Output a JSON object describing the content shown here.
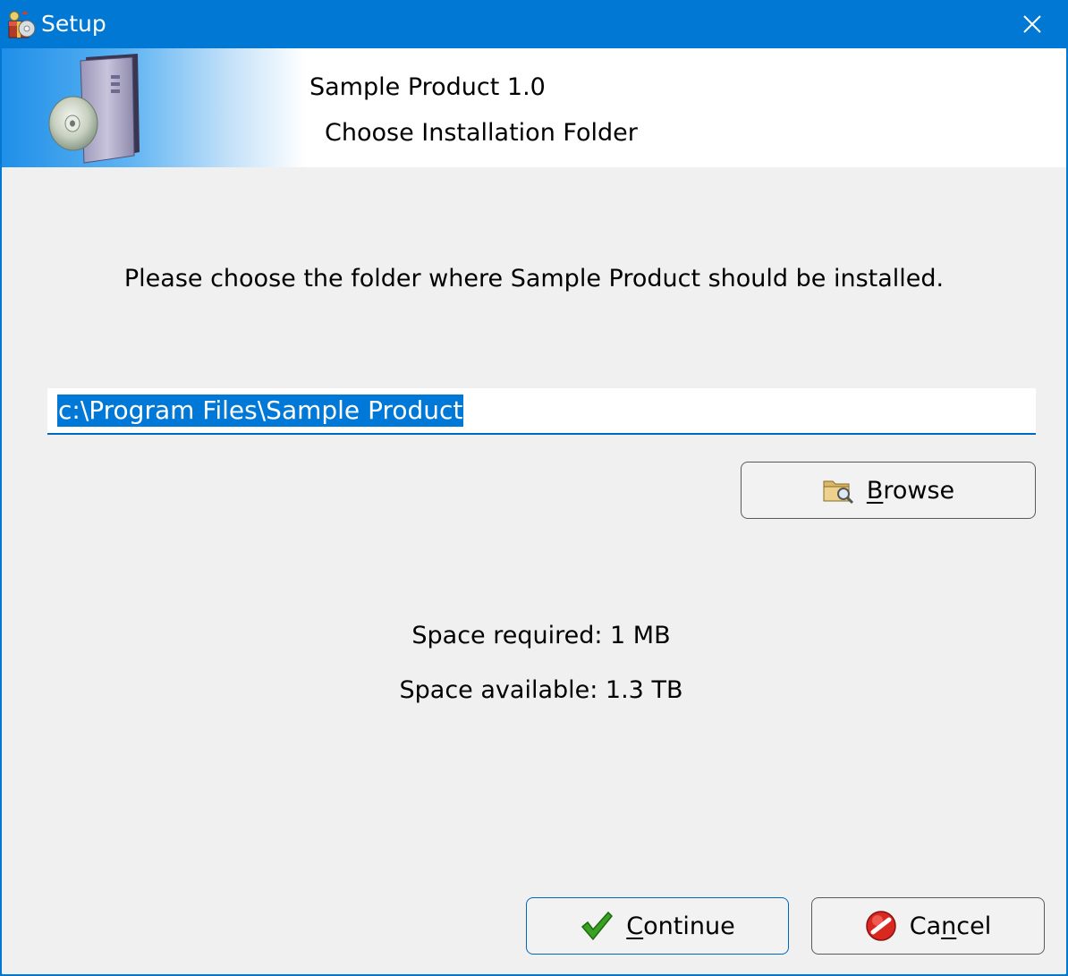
{
  "window": {
    "title": "Setup",
    "close_icon": "close-icon",
    "app_icon": "setup-package-icon"
  },
  "banner": {
    "product_title": "Sample Product 1.0",
    "step_title": "Choose Installation Folder",
    "art_icon": "software-box-cd-icon"
  },
  "main": {
    "instruction": "Please choose the folder where Sample Product should be installed.",
    "install_path": "c:\\Program Files\\Sample Product",
    "browse_button": {
      "mnemonic": "B",
      "rest": "rowse",
      "icon": "folder-search-icon"
    },
    "space_required": "Space required: 1 MB",
    "space_available": "Space available: 1.3 TB"
  },
  "footer": {
    "continue_button": {
      "mnemonic": "C",
      "rest": "ontinue",
      "icon": "green-check-icon"
    },
    "cancel_button": {
      "before": "Ca",
      "mnemonic": "n",
      "rest": "cel",
      "icon": "red-no-icon"
    }
  },
  "colors": {
    "titlebar": "#0078d4",
    "selection": "#0078d7",
    "dialog_bg": "#f0f0f0"
  }
}
